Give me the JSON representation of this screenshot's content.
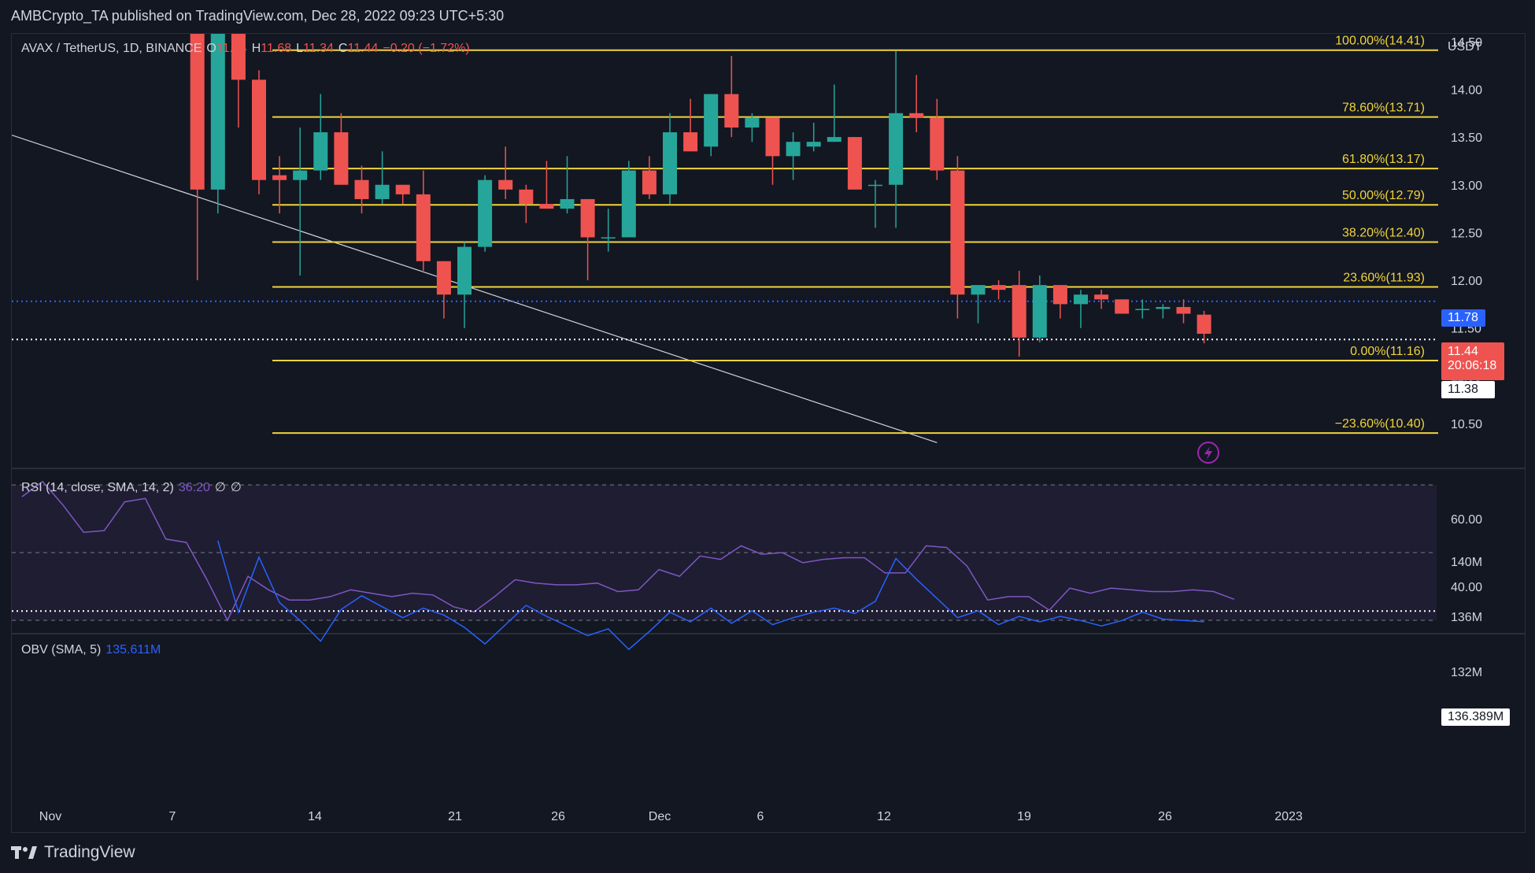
{
  "publisher": "AMBCrypto_TA published on TradingView.com, Dec 28, 2022 09:23 UTC+5:30",
  "legend": {
    "symbol": "AVAX / TetherUS, 1D, BINANCE",
    "o_label": "O",
    "o_value": "11.64",
    "h_label": "H",
    "h_value": "11.68",
    "l_label": "L",
    "l_value": "11.34",
    "c_label": "C",
    "c_value": "11.44",
    "change": "−0.20 (−1.72%)"
  },
  "currency": "USDT",
  "rsi_legend": {
    "label": "RSI (14, close, SMA, 14, 2)",
    "value": "36.20",
    "extra1": "∅",
    "extra2": "∅"
  },
  "obv_legend": {
    "label": "OBV (SMA, 5)",
    "value": "135.611M"
  },
  "footer": "TradingView",
  "tags": {
    "blue_line": "11.78",
    "last_price": "11.44",
    "countdown": "20:06:18",
    "white_line": "11.38",
    "obv_line": "136.389M"
  },
  "colors": {
    "up": "#26a69a",
    "down": "#ef5350",
    "fib": "#f0d43a",
    "rsi": "#7e57c2",
    "obv": "#2962ff",
    "blue_dotted": "#2962ff"
  },
  "chart_data": [
    {
      "type": "candlestick",
      "title": "AVAX / TetherUS, 1D, BINANCE",
      "ylabel": "USDT",
      "ylim": [
        10.3,
        14.8
      ],
      "x_ticks": [
        "Nov",
        "7",
        "14",
        "21",
        "26",
        "Dec",
        "6",
        "12",
        "19",
        "26",
        "2023"
      ],
      "y_ticks": [
        "10.50",
        "11.00",
        "11.50",
        "12.00",
        "12.50",
        "13.00",
        "13.50",
        "14.00",
        "14.50"
      ],
      "candles": [
        {
          "day": 8,
          "o": 14.9,
          "h": 15.0,
          "l": 12.0,
          "c": 12.95
        },
        {
          "day": 9,
          "o": 12.95,
          "h": 15.0,
          "l": 12.7,
          "c": 14.8
        },
        {
          "day": 10,
          "o": 14.8,
          "h": 15.0,
          "l": 13.6,
          "c": 14.1
        },
        {
          "day": 11,
          "o": 14.1,
          "h": 14.2,
          "l": 12.9,
          "c": 13.05
        },
        {
          "day": 12,
          "o": 13.1,
          "h": 13.3,
          "l": 12.7,
          "c": 13.05
        },
        {
          "day": 13,
          "o": 13.05,
          "h": 13.6,
          "l": 12.05,
          "c": 13.15
        },
        {
          "day": 14,
          "o": 13.15,
          "h": 13.95,
          "l": 13.05,
          "c": 13.55
        },
        {
          "day": 15,
          "o": 13.55,
          "h": 13.75,
          "l": 13.0,
          "c": 13.0
        },
        {
          "day": 16,
          "o": 13.05,
          "h": 13.2,
          "l": 12.7,
          "c": 12.85
        },
        {
          "day": 17,
          "o": 12.85,
          "h": 13.35,
          "l": 12.8,
          "c": 13.0
        },
        {
          "day": 18,
          "o": 13.0,
          "h": 13.0,
          "l": 12.8,
          "c": 12.9
        },
        {
          "day": 19,
          "o": 12.9,
          "h": 13.15,
          "l": 12.1,
          "c": 12.2
        },
        {
          "day": 20,
          "o": 12.2,
          "h": 12.2,
          "l": 11.6,
          "c": 11.85
        },
        {
          "day": 21,
          "o": 11.85,
          "h": 12.4,
          "l": 11.5,
          "c": 12.35
        },
        {
          "day": 22,
          "o": 12.35,
          "h": 13.1,
          "l": 12.3,
          "c": 13.05
        },
        {
          "day": 23,
          "o": 13.05,
          "h": 13.4,
          "l": 12.85,
          "c": 12.95
        },
        {
          "day": 24,
          "o": 12.95,
          "h": 13.0,
          "l": 12.6,
          "c": 12.8
        },
        {
          "day": 25,
          "o": 12.8,
          "h": 13.25,
          "l": 12.75,
          "c": 12.75
        },
        {
          "day": 26,
          "o": 12.75,
          "h": 13.3,
          "l": 12.7,
          "c": 12.85
        },
        {
          "day": 27,
          "o": 12.85,
          "h": 12.85,
          "l": 12.0,
          "c": 12.45
        },
        {
          "day": 28,
          "o": 12.45,
          "h": 12.75,
          "l": 12.3,
          "c": 12.45
        },
        {
          "day": 29,
          "o": 12.45,
          "h": 13.25,
          "l": 12.45,
          "c": 13.15
        },
        {
          "day": 30,
          "o": 13.15,
          "h": 13.3,
          "l": 12.85,
          "c": 12.9
        },
        {
          "day": 31,
          "o": 12.9,
          "h": 13.75,
          "l": 12.8,
          "c": 13.55
        },
        {
          "day": 32,
          "o": 13.55,
          "h": 13.9,
          "l": 13.35,
          "c": 13.35
        },
        {
          "day": 33,
          "o": 13.4,
          "h": 13.95,
          "l": 13.3,
          "c": 13.95
        },
        {
          "day": 34,
          "o": 13.95,
          "h": 14.35,
          "l": 13.5,
          "c": 13.6
        },
        {
          "day": 35,
          "o": 13.6,
          "h": 13.75,
          "l": 13.45,
          "c": 13.7
        },
        {
          "day": 36,
          "o": 13.7,
          "h": 13.7,
          "l": 13.0,
          "c": 13.3
        },
        {
          "day": 37,
          "o": 13.3,
          "h": 13.55,
          "l": 13.05,
          "c": 13.45
        },
        {
          "day": 38,
          "o": 13.4,
          "h": 13.65,
          "l": 13.35,
          "c": 13.45
        },
        {
          "day": 39,
          "o": 13.45,
          "h": 14.05,
          "l": 13.45,
          "c": 13.5
        },
        {
          "day": 40,
          "o": 13.5,
          "h": 13.5,
          "l": 12.95,
          "c": 12.95
        },
        {
          "day": 41,
          "o": 13.0,
          "h": 13.05,
          "l": 12.55,
          "c": 13.0
        },
        {
          "day": 42,
          "o": 13.0,
          "h": 14.4,
          "l": 12.55,
          "c": 13.75
        },
        {
          "day": 43,
          "o": 13.75,
          "h": 14.15,
          "l": 13.55,
          "c": 13.7
        },
        {
          "day": 44,
          "o": 13.7,
          "h": 13.9,
          "l": 13.05,
          "c": 13.15
        },
        {
          "day": 45,
          "o": 13.15,
          "h": 13.3,
          "l": 11.6,
          "c": 11.85
        },
        {
          "day": 46,
          "o": 11.85,
          "h": 11.95,
          "l": 11.55,
          "c": 11.95
        },
        {
          "day": 47,
          "o": 11.95,
          "h": 12.0,
          "l": 11.8,
          "c": 11.9
        },
        {
          "day": 48,
          "o": 11.95,
          "h": 12.1,
          "l": 11.2,
          "c": 11.4
        },
        {
          "day": 49,
          "o": 11.4,
          "h": 12.05,
          "l": 11.35,
          "c": 11.95
        },
        {
          "day": 50,
          "o": 11.95,
          "h": 11.95,
          "l": 11.6,
          "c": 11.75
        },
        {
          "day": 51,
          "o": 11.75,
          "h": 11.9,
          "l": 11.5,
          "c": 11.85
        },
        {
          "day": 52,
          "o": 11.85,
          "h": 11.9,
          "l": 11.7,
          "c": 11.8
        },
        {
          "day": 53,
          "o": 11.8,
          "h": 11.8,
          "l": 11.65,
          "c": 11.65
        },
        {
          "day": 54,
          "o": 11.7,
          "h": 11.8,
          "l": 11.6,
          "c": 11.7
        },
        {
          "day": 55,
          "o": 11.7,
          "h": 11.75,
          "l": 11.6,
          "c": 11.72
        },
        {
          "day": 56,
          "o": 11.72,
          "h": 11.8,
          "l": 11.55,
          "c": 11.65
        },
        {
          "day": 57,
          "o": 11.64,
          "h": 11.68,
          "l": 11.34,
          "c": 11.44
        }
      ],
      "fib_levels": [
        {
          "label": "100.00%(14.41)",
          "price": 14.41
        },
        {
          "label": "78.60%(13.71)",
          "price": 13.71
        },
        {
          "label": "61.80%(13.17)",
          "price": 13.17
        },
        {
          "label": "50.00%(12.79)",
          "price": 12.79
        },
        {
          "label": "38.20%(12.40)",
          "price": 12.4
        },
        {
          "label": "23.60%(11.93)",
          "price": 11.93
        },
        {
          "label": "0.00%(11.16)",
          "price": 11.16
        },
        {
          "label": "−23.60%(10.40)",
          "price": 10.4
        }
      ],
      "horizontal_lines": [
        {
          "price": 11.78,
          "style": "dotted",
          "color": "blue"
        },
        {
          "price": 11.38,
          "style": "dotted",
          "color": "white"
        }
      ],
      "trendline": [
        {
          "day": 1,
          "price": 13.52
        },
        {
          "day": 44,
          "price": 10.3
        }
      ]
    },
    {
      "type": "line",
      "title": "RSI (14, close, SMA, 14, 2)",
      "ylim": [
        27,
        72
      ],
      "y_ticks": [
        "40.00",
        "60.00"
      ],
      "bands": [
        30,
        50,
        70
      ],
      "x": [
        1,
        2,
        3,
        4,
        5,
        6,
        7,
        8,
        9,
        10,
        11,
        12,
        13,
        14,
        15,
        16,
        17,
        18,
        19,
        20,
        21,
        22,
        23,
        24,
        25,
        26,
        27,
        28,
        29,
        30,
        31,
        32,
        33,
        34,
        35,
        36,
        37,
        38,
        39,
        40,
        41,
        42,
        43,
        44,
        45,
        46,
        47,
        48,
        49,
        50,
        51,
        52,
        53,
        54,
        55,
        56,
        57
      ],
      "values": [
        66.5,
        71,
        64,
        56,
        56.5,
        65,
        66,
        54,
        53,
        42,
        30,
        43,
        39,
        36,
        36,
        37,
        39,
        38,
        37,
        38,
        37.5,
        34,
        32.5,
        37,
        42,
        41,
        40.5,
        40.5,
        41,
        38.5,
        39,
        45,
        43,
        49,
        48,
        52,
        49.5,
        50,
        47,
        48,
        48.5,
        48.5,
        44,
        44,
        52,
        51.5,
        46,
        36,
        37,
        37,
        33,
        39.5,
        38,
        39.5,
        39,
        38.5,
        38.5,
        39,
        38.5,
        36.2
      ]
    },
    {
      "type": "line",
      "title": "OBV (SMA, 5)",
      "ylim": [
        131,
        141.5
      ],
      "y_ticks": [
        "132M",
        "136M",
        "140M"
      ],
      "level_line": 136.389,
      "x": [
        9,
        10,
        11,
        12,
        13,
        14,
        15,
        16,
        17,
        18,
        19,
        20,
        21,
        22,
        23,
        24,
        25,
        26,
        27,
        28,
        29,
        30,
        31,
        32,
        33,
        34,
        35,
        36,
        37,
        38,
        39,
        40,
        41,
        42,
        43,
        44,
        45,
        46,
        47,
        48,
        49,
        50,
        51,
        52,
        53,
        54,
        55,
        56,
        57
      ],
      "values": [
        141.5,
        136.3,
        140.3,
        137.0,
        135.7,
        134.2,
        136.5,
        137.5,
        136.7,
        135.9,
        136.6,
        136.1,
        135.2,
        134.0,
        135.4,
        136.8,
        136.0,
        135.3,
        134.6,
        135.1,
        133.6,
        134.9,
        136.3,
        135.6,
        136.6,
        135.5,
        136.4,
        135.4,
        135.9,
        136.3,
        136.6,
        136.2,
        137.1,
        140.2,
        138.7,
        137.3,
        135.9,
        136.4,
        135.4,
        136.0,
        135.6,
        136.0,
        135.7,
        135.3,
        135.7,
        136.3,
        135.8,
        135.7,
        135.611
      ]
    }
  ]
}
